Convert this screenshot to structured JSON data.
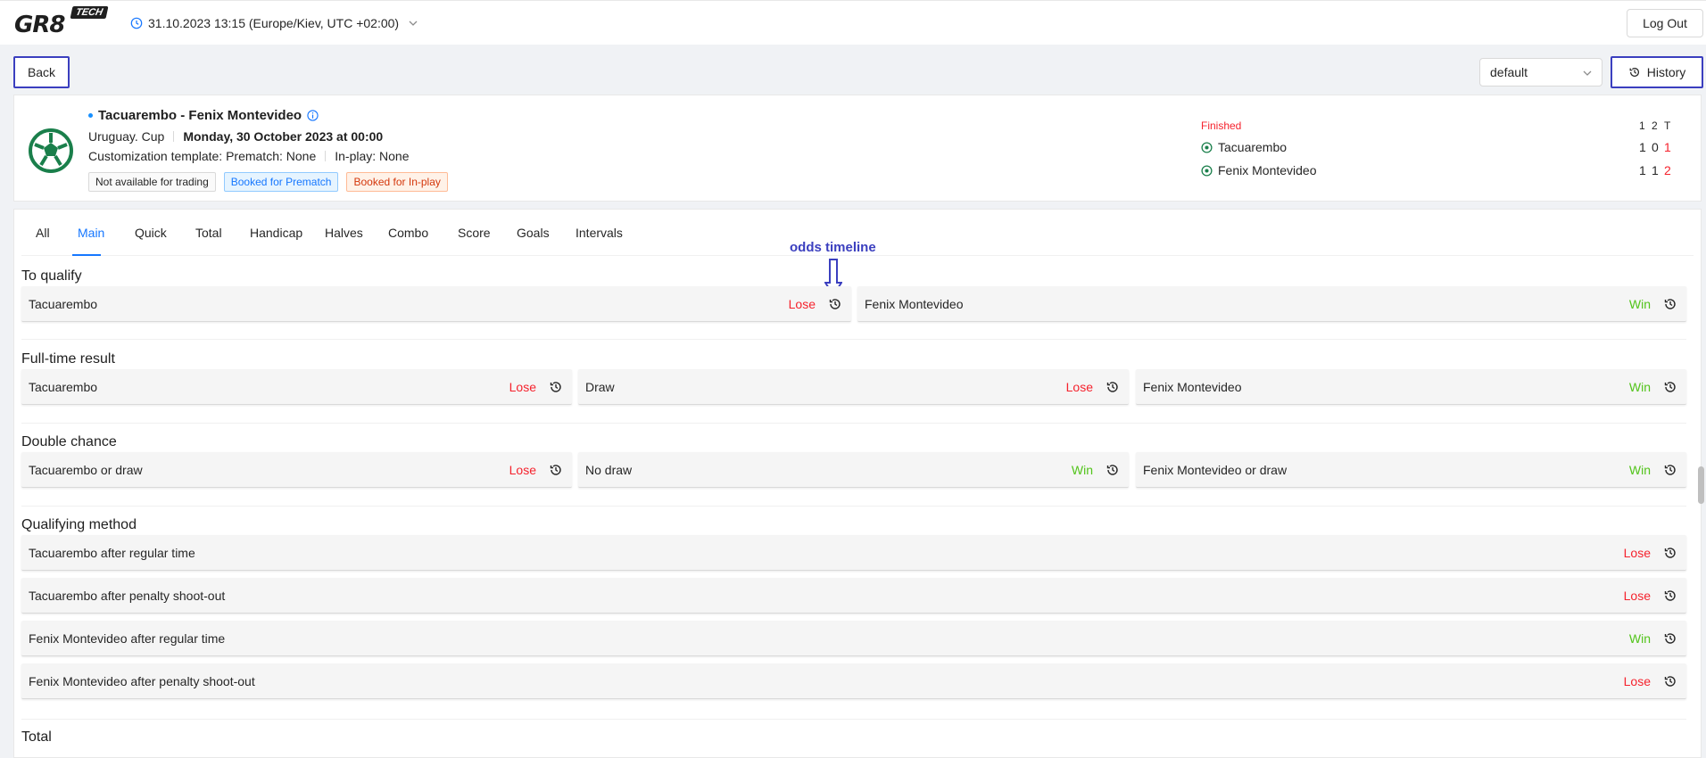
{
  "header": {
    "logo_text": "GR8",
    "logo_badge": "TECH",
    "timezone": "31.10.2023 13:15 (Europe/Kiev, UTC +02:00)",
    "logout_label": "Log Out"
  },
  "toolbar": {
    "back_label": "Back",
    "select_value": "default",
    "history_label": "History"
  },
  "event": {
    "title": "Tacuarembo - Fenix Montevideo",
    "competition": "Uruguay. Cup",
    "date": "Monday, 30 October 2023 at 00:00",
    "customization": "Customization template: Prematch: None",
    "inplay": "In-play: None",
    "tags": {
      "not_available": "Not available for trading",
      "booked_prematch": "Booked for Prematch",
      "booked_inplay": "Booked for In-play"
    },
    "status": "Finished",
    "score_headers": [
      "1",
      "2",
      "T"
    ],
    "teams": [
      {
        "name": "Tacuarembo",
        "scores": [
          "1",
          "0",
          "1"
        ]
      },
      {
        "name": "Fenix Montevideo",
        "scores": [
          "1",
          "1",
          "2"
        ]
      }
    ]
  },
  "tabs": [
    "All",
    "Main",
    "Quick",
    "Total",
    "Handicap",
    "Halves",
    "Combo",
    "Score",
    "Goals",
    "Intervals"
  ],
  "annotation": "odds timeline",
  "markets": {
    "to_qualify": {
      "title": "To qualify",
      "outcomes": [
        {
          "name": "Tacuarembo",
          "result": "Lose"
        },
        {
          "name": "Fenix Montevideo",
          "result": "Win"
        }
      ]
    },
    "full_time": {
      "title": "Full-time result",
      "outcomes": [
        {
          "name": "Tacuarembo",
          "result": "Lose"
        },
        {
          "name": "Draw",
          "result": "Lose"
        },
        {
          "name": "Fenix Montevideo",
          "result": "Win"
        }
      ]
    },
    "double_chance": {
      "title": "Double chance",
      "outcomes": [
        {
          "name": "Tacuarembo or draw",
          "result": "Lose"
        },
        {
          "name": "No draw",
          "result": "Win"
        },
        {
          "name": "Fenix Montevideo or draw",
          "result": "Win"
        }
      ]
    },
    "qualifying_method": {
      "title": "Qualifying method",
      "outcomes": [
        {
          "name": "Tacuarembo after regular time",
          "result": "Lose"
        },
        {
          "name": "Tacuarembo after penalty shoot-out",
          "result": "Lose"
        },
        {
          "name": "Fenix Montevideo after regular time",
          "result": "Win"
        },
        {
          "name": "Fenix Montevideo after penalty shoot-out",
          "result": "Lose"
        }
      ]
    },
    "total": {
      "title": "Total"
    }
  },
  "colors": {
    "lose": "#f5222d",
    "win": "#52c41a",
    "accent": "#1677ff",
    "annotation": "#3b3fbf"
  }
}
